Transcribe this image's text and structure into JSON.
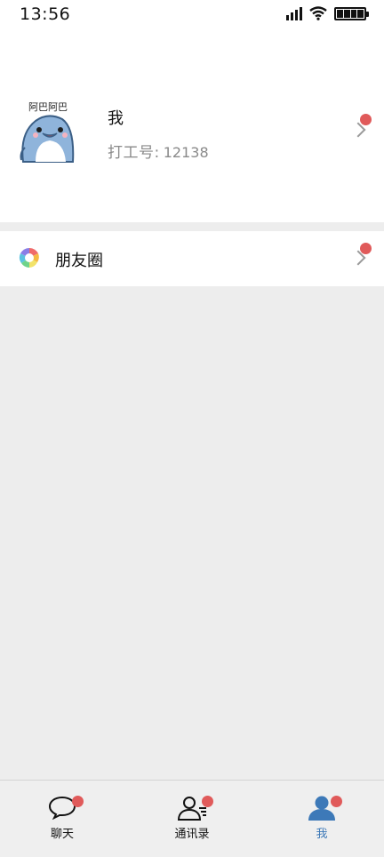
{
  "status_bar": {
    "time": "13:56"
  },
  "profile": {
    "name": "我",
    "id_label": "打工号:",
    "id_value": "12138",
    "avatar_text": "阿巴阿巴"
  },
  "menu": {
    "moments_label": "朋友圈"
  },
  "tabbar": {
    "tabs": [
      {
        "label": "聊天",
        "icon": "chat-bubble-icon",
        "active": false
      },
      {
        "label": "通讯录",
        "icon": "contacts-icon",
        "active": false
      },
      {
        "label": "我",
        "icon": "me-person-icon",
        "active": true
      }
    ]
  },
  "colors": {
    "badge": "#e05a5a",
    "active_tab": "#3d79b8",
    "background": "#ededed"
  }
}
